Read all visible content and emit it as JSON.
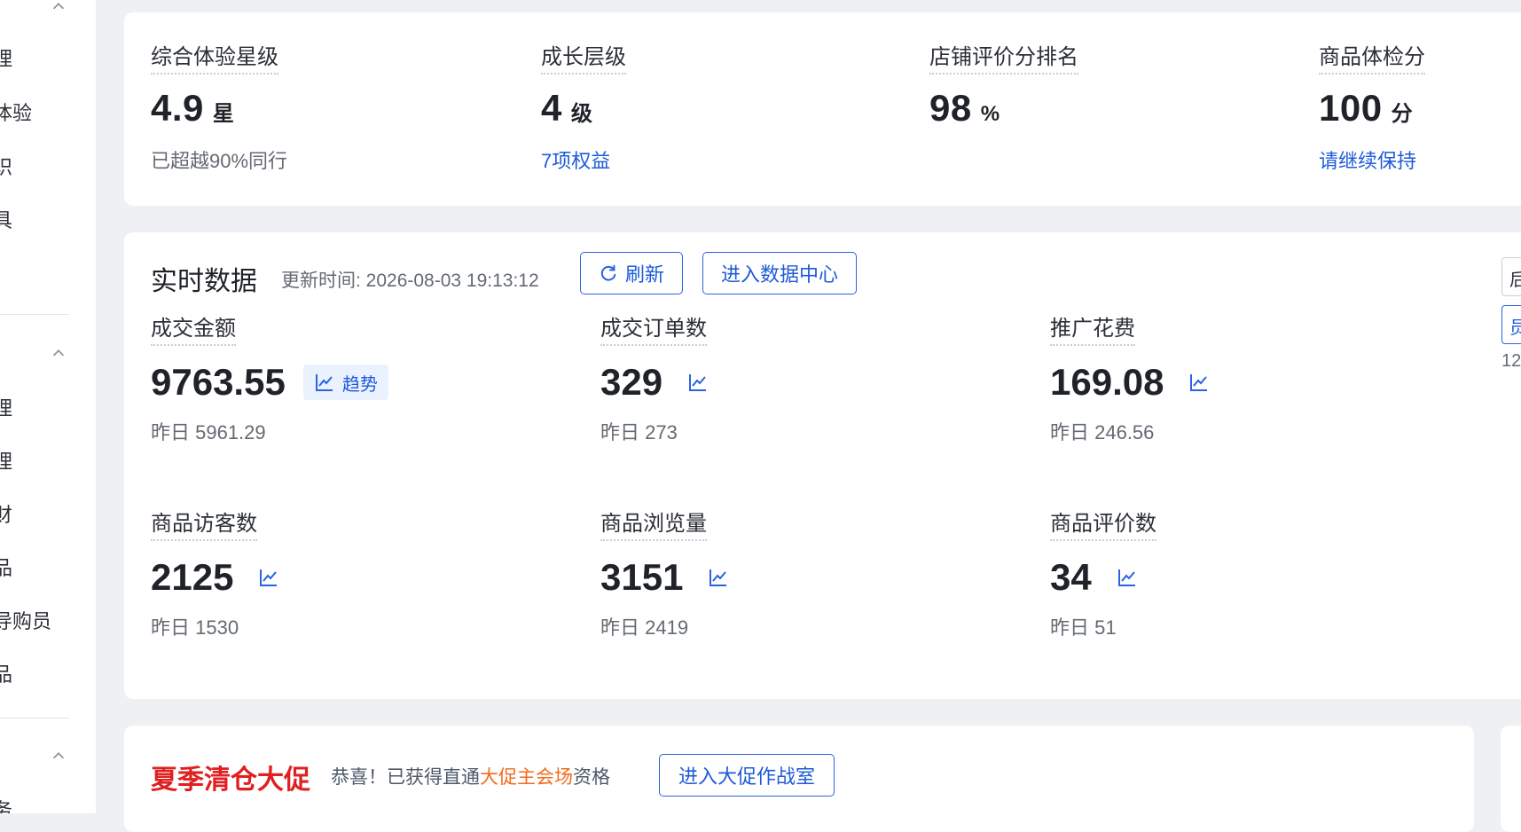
{
  "sidebar": {
    "groups": [
      {
        "items": [
          "理",
          "体验",
          "识",
          "具"
        ]
      },
      {
        "items": [
          "理",
          "理",
          "财",
          "品",
          "导购员",
          "品"
        ]
      },
      {
        "items": [
          "务"
        ]
      }
    ]
  },
  "overview": {
    "metrics": [
      {
        "label": "综合体验星级",
        "value": "4.9",
        "unit": "星",
        "sub": "已超越90%同行",
        "sub_link": false
      },
      {
        "label": "成长层级",
        "value": "4",
        "unit": "级",
        "sub": "7项权益",
        "sub_link": true
      },
      {
        "label": "店铺评价分排名",
        "value": "98",
        "unit": "%",
        "sub": "",
        "sub_link": false
      },
      {
        "label": "商品体检分",
        "value": "100",
        "unit": "分",
        "sub": "请继续保持",
        "sub_link": true
      }
    ]
  },
  "realtime": {
    "title": "实时数据",
    "update_time": "更新时间: 2026-08-03 19:13:12",
    "refresh_label": "刷新",
    "datacenter_label": "进入数据中心",
    "trend_label": "趋势",
    "metrics": [
      {
        "label": "成交金额",
        "value": "9763.55",
        "yesterday": "昨日 5961.29",
        "chip": true
      },
      {
        "label": "成交订单数",
        "value": "329",
        "yesterday": "昨日 273",
        "chip": false
      },
      {
        "label": "推广花费",
        "value": "169.08",
        "yesterday": "昨日 246.56",
        "chip": false
      },
      {
        "label": "商品访客数",
        "value": "2125",
        "yesterday": "昨日 1530",
        "chip": false
      },
      {
        "label": "商品浏览量",
        "value": "3151",
        "yesterday": "昨日 2419",
        "chip": false
      },
      {
        "label": "商品评价数",
        "value": "34",
        "yesterday": "昨日 51",
        "chip": false
      }
    ],
    "edge_fragments": [
      "后",
      "员",
      "12"
    ]
  },
  "promo": {
    "title": "夏季清仓大促",
    "text_before": "恭喜！已获得直通",
    "text_highlight": "大促主会场",
    "text_after": "资格",
    "button_label": "进入大促作战室"
  },
  "colors": {
    "accent_blue": "#2a63e0",
    "promo_red": "#e02020",
    "highlight_orange": "#f26b1d",
    "page_bg": "#eef0f3"
  }
}
